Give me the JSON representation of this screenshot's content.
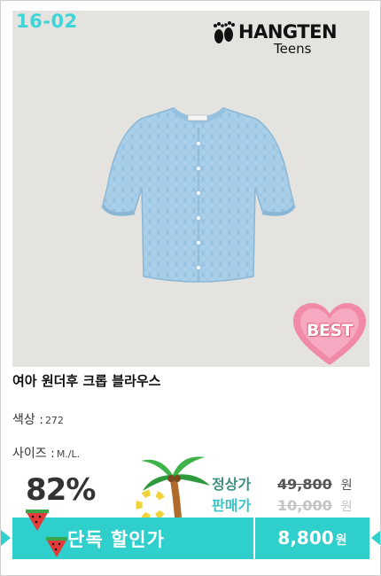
{
  "product_code": "16-02",
  "brand": {
    "name": "HANGTEN",
    "sub": "Teens"
  },
  "badge": "BEST",
  "product": {
    "title": "여아 원더후 크롭 블라우스",
    "color_label": "색상 :",
    "color_value": "272",
    "size_label": "사이즈 :",
    "size_value": "M./L."
  },
  "pricing": {
    "discount": "82%",
    "regular_label": "정상가",
    "regular_price": "49,800",
    "sale_label": "판매가",
    "sale_price": "10,000",
    "unit": "원",
    "promo_label": "단독 할인가",
    "promo_price": "8,800",
    "promo_unit": "원"
  },
  "colors": {
    "accent": "#2fcfcc",
    "code": "#3dd6d8",
    "regular": "#3d8f82",
    "shirt": "#a9cfe9",
    "badge": "#f08aa7"
  }
}
